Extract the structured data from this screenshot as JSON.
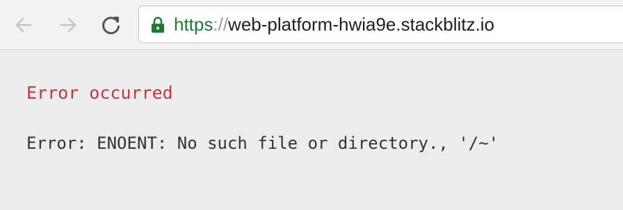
{
  "browser": {
    "url_scheme": "https",
    "url_separator": "://",
    "url_host": "web-platform-hwia9e.stackblitz.io",
    "back_icon": "arrow-left-icon",
    "forward_icon": "arrow-right-icon",
    "reload_icon": "reload-icon",
    "secure_icon": "lock-icon",
    "secure_color": "#1f7a35"
  },
  "page": {
    "title": "Error occurred",
    "title_color": "#c0393b",
    "message": "Error: ENOENT: No such file or directory., '/~'"
  }
}
